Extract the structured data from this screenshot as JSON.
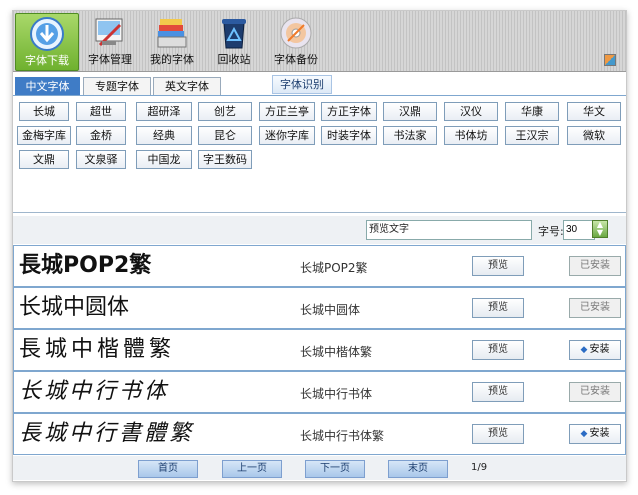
{
  "toolbar": {
    "items": [
      {
        "label": "字体下载",
        "icon": "download-icon",
        "active": true
      },
      {
        "label": "字体管理",
        "icon": "font-manage-icon",
        "active": false
      },
      {
        "label": "我的字体",
        "icon": "my-fonts-icon",
        "active": false
      },
      {
        "label": "回收站",
        "icon": "recycle-bin-icon",
        "active": false
      },
      {
        "label": "字体备份",
        "icon": "backup-disc-icon",
        "active": false
      }
    ]
  },
  "tabs": [
    {
      "label": "中文字体",
      "active": true
    },
    {
      "label": "专题字体",
      "active": false
    },
    {
      "label": "英文字体",
      "active": false
    }
  ],
  "ocr_tab": "字体识别",
  "font_buttons": [
    [
      "长城",
      "超世",
      "超研泽",
      "创艺",
      "方正兰亭",
      "方正字体",
      "汉鼎",
      "汉仪",
      "华康",
      "华文"
    ],
    [
      "金梅字库",
      "金桥",
      "经典",
      "昆仑",
      "迷你字库",
      "时装字体",
      "书法家",
      "书体坊",
      "王汉宗",
      "微软"
    ],
    [
      "文鼎",
      "文泉驿",
      "中国龙",
      "字王数码"
    ]
  ],
  "preview": {
    "text": "预览文字",
    "size_label": "字号:",
    "size_value": "30"
  },
  "fonts": [
    {
      "sample": "長城POP2繁",
      "name": "长城POP2繁",
      "preview_label": "预览",
      "action": "已安装",
      "installed": true
    },
    {
      "sample": "长城中圆体",
      "name": "长城中圆体",
      "preview_label": "预览",
      "action": "已安装",
      "installed": true
    },
    {
      "sample": "長城中楷體繁",
      "name": "长城中楷体繁",
      "preview_label": "预览",
      "action": "安装",
      "installed": false
    },
    {
      "sample": "长城中行书体",
      "name": "长城中行书体",
      "preview_label": "预览",
      "action": "已安装",
      "installed": true
    },
    {
      "sample": "長城中行書體繁",
      "name": "长城中行书体繁",
      "preview_label": "预览",
      "action": "安装",
      "installed": false
    }
  ],
  "pager": {
    "first": "首页",
    "prev": "上一页",
    "next": "下一页",
    "last": "末页",
    "info": "1/9"
  }
}
